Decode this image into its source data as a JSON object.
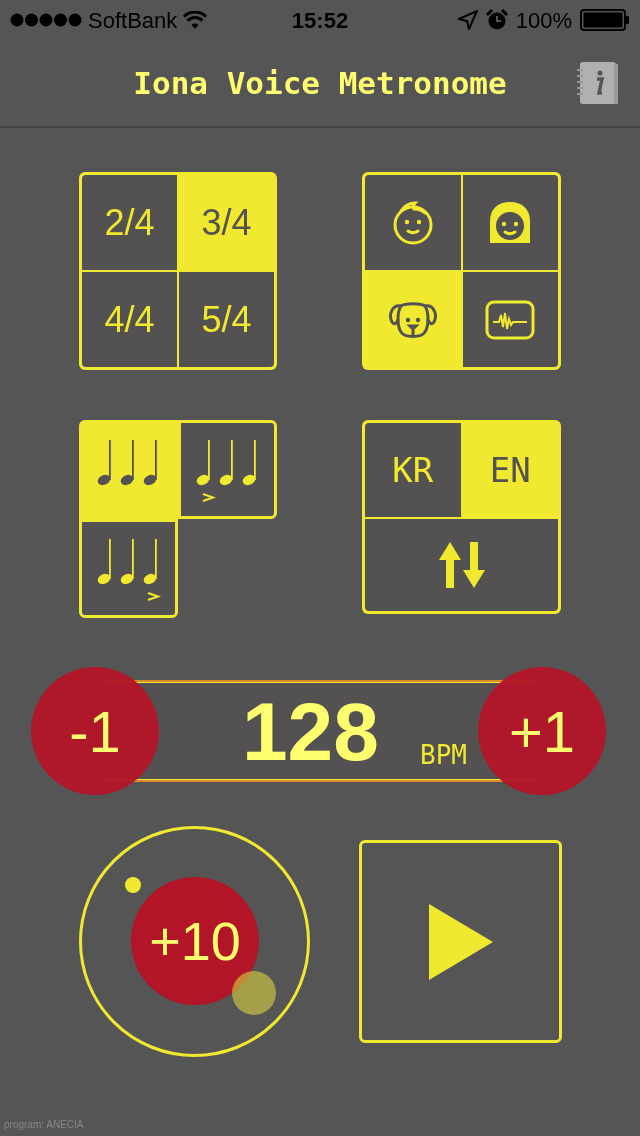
{
  "status_bar": {
    "carrier": "SoftBank",
    "time": "15:52",
    "battery": "100%"
  },
  "title": "Iona Voice Metronome",
  "time_signatures": [
    {
      "label": "2/4",
      "selected": false
    },
    {
      "label": "3/4",
      "selected": true
    },
    {
      "label": "4/4",
      "selected": false
    },
    {
      "label": "5/4",
      "selected": false
    }
  ],
  "voices": [
    {
      "kind": "boy",
      "selected": false
    },
    {
      "kind": "girl",
      "selected": false
    },
    {
      "kind": "dog",
      "selected": true
    },
    {
      "kind": "wave",
      "selected": false
    }
  ],
  "accents": [
    {
      "kind": "none",
      "selected": true
    },
    {
      "kind": "first",
      "selected": false
    },
    {
      "kind": "last",
      "selected": false
    }
  ],
  "languages": [
    {
      "label": "KR",
      "selected": false
    },
    {
      "label": "EN",
      "selected": true
    }
  ],
  "tempo": {
    "value": "128",
    "unit": "BPM",
    "minus": "-1",
    "plus": "+1",
    "plus_ten": "+10"
  },
  "footer": "program: ANECIA"
}
